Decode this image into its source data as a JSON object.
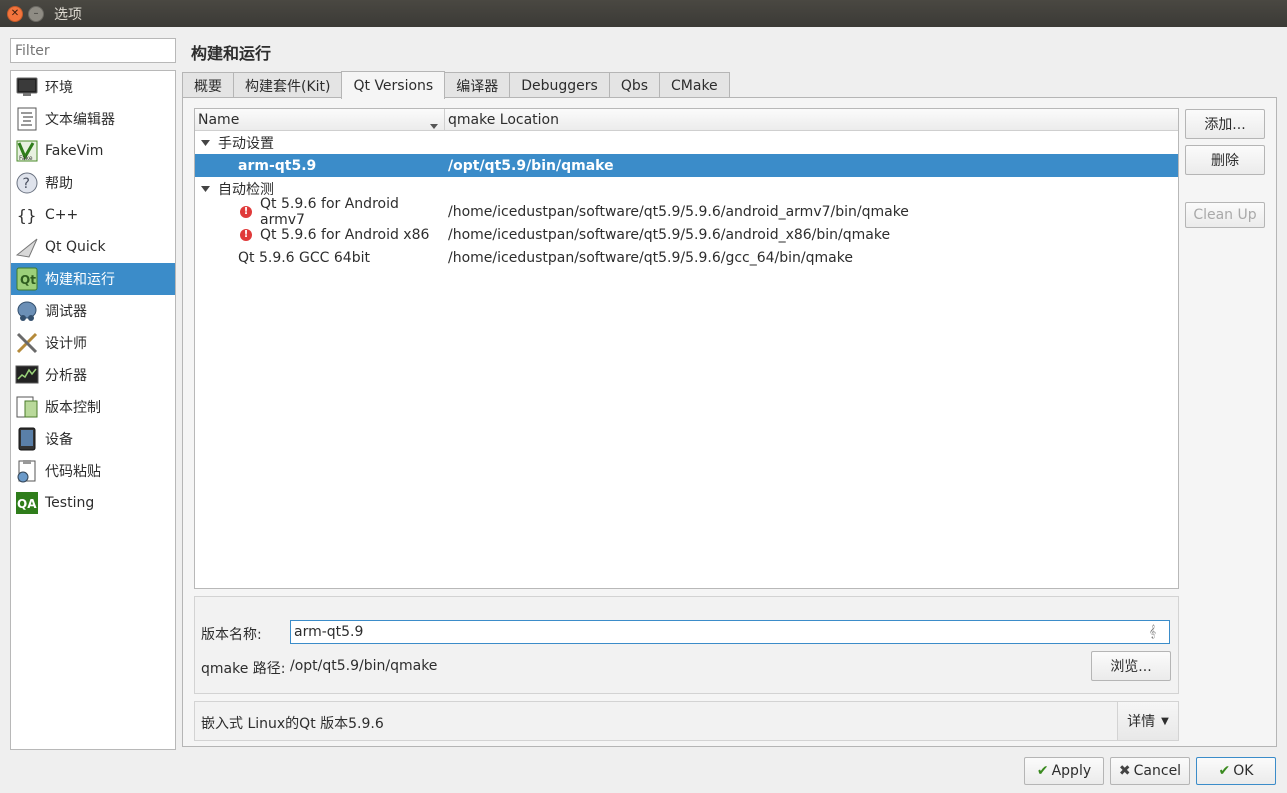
{
  "window": {
    "title": "选项"
  },
  "filter": {
    "placeholder": "Filter"
  },
  "categories": [
    {
      "label": "环境",
      "icon": "monitor-icon"
    },
    {
      "label": "文本编辑器",
      "icon": "text-editor-icon"
    },
    {
      "label": "FakeVim",
      "icon": "fakevim-icon"
    },
    {
      "label": "帮助",
      "icon": "help-icon"
    },
    {
      "label": "C++",
      "icon": "braces-icon"
    },
    {
      "label": "Qt Quick",
      "icon": "qt-quick-icon"
    },
    {
      "label": "构建和运行",
      "icon": "build-run-icon",
      "selected": true
    },
    {
      "label": "调试器",
      "icon": "debugger-icon"
    },
    {
      "label": "设计师",
      "icon": "designer-icon"
    },
    {
      "label": "分析器",
      "icon": "analyzer-icon"
    },
    {
      "label": "版本控制",
      "icon": "version-control-icon"
    },
    {
      "label": "设备",
      "icon": "device-icon"
    },
    {
      "label": "代码粘贴",
      "icon": "code-paste-icon"
    },
    {
      "label": "Testing",
      "icon": "testing-qa-icon"
    }
  ],
  "page": {
    "title": "构建和运行"
  },
  "tabs": [
    "概要",
    "构建套件(Kit)",
    "Qt Versions",
    "编译器",
    "Debuggers",
    "Qbs",
    "CMake"
  ],
  "active_tab": "Qt Versions",
  "tree": {
    "columns": [
      "Name",
      "qmake Location"
    ],
    "groups": [
      {
        "label": "手动设置",
        "items": [
          {
            "name": "arm-qt5.9",
            "location": "/opt/qt5.9/bin/qmake",
            "error": false,
            "selected": true
          }
        ]
      },
      {
        "label": "自动检测",
        "items": [
          {
            "name": "Qt 5.9.6 for Android armv7",
            "location": "/home/icedustpan/software/qt5.9/5.9.6/android_armv7/bin/qmake",
            "error": true
          },
          {
            "name": "Qt 5.9.6 for Android x86",
            "location": "/home/icedustpan/software/qt5.9/5.9.6/android_x86/bin/qmake",
            "error": true
          },
          {
            "name": "Qt 5.9.6 GCC 64bit",
            "location": "/home/icedustpan/software/qt5.9/5.9.6/gcc_64/bin/qmake",
            "error": false
          }
        ]
      }
    ]
  },
  "side_buttons": {
    "add": "添加...",
    "remove": "删除",
    "cleanup": "Clean Up"
  },
  "details": {
    "version_name_label": "版本名称:",
    "version_name_value": "arm-qt5.9",
    "qmake_path_label": "qmake 路径:",
    "qmake_path_value": "/opt/qt5.9/bin/qmake",
    "browse": "浏览...",
    "info": "嵌入式 Linux的Qt 版本5.9.6",
    "details_button": "详情"
  },
  "dialog_buttons": {
    "apply": "Apply",
    "cancel": "Cancel",
    "ok": "OK"
  }
}
